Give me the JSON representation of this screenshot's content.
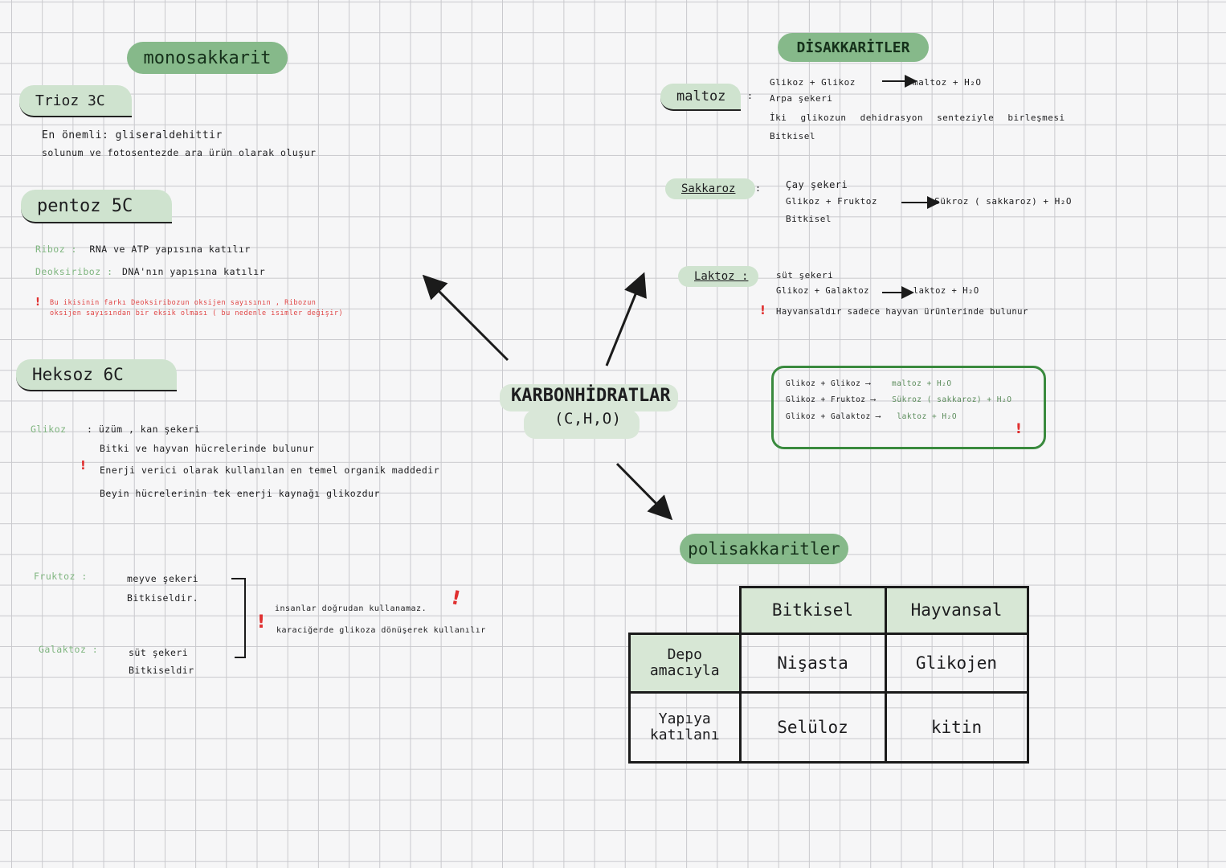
{
  "center": {
    "title": "KARBONHİDRATLAR",
    "formula": "(C,H,O)"
  },
  "monosakkarit": {
    "title": "monosakkarit",
    "trioz": {
      "title": "Trioz 3C",
      "lines": [
        "En önemli: gliseraldehittir",
        "solunum ve fotosentezde ara ürün olarak oluşur"
      ]
    },
    "pentoz": {
      "title": "pentoz 5C",
      "riboz_label": "Riboz :",
      "riboz_text": "RNA ve ATP yapısına katılır",
      "deoksiriboz_label": "Deoksiriboz :",
      "deoksiriboz_text": "DNA'nın yapısına katılır",
      "note_line1": "Bu ikisinin farkı Deoksiribozun oksijen sayısının , Ribozun",
      "note_line2": "oksijen sayısından bir eksik olması ( bu nedenle isimler değişir)"
    },
    "heksoz": {
      "title": "Heksoz 6C",
      "glikoz_label": "Glikoz",
      "glikoz_lines": [
        ": üzüm , kan şekeri",
        "Bitki ve hayvan hücrelerinde bulunur",
        "Enerji verici olarak kullanılan en temel organik maddedir",
        "Beyin hücrelerinin tek enerji kaynağı glikozdur"
      ],
      "fruktoz_label": "Fruktoz :",
      "fruktoz_lines": [
        "meyve şekeri",
        "Bitkiseldir."
      ],
      "galaktoz_label": "Galaktoz :",
      "galaktoz_lines": [
        "süt şekeri",
        "Bitkiseldir"
      ],
      "bracket_note_line1": "insanlar doğrudan kullanamaz.",
      "bracket_note_line2": "karaciğerde glikoza dönüşerek kullanılır"
    }
  },
  "disakkaritler": {
    "title": "DİSAKKARİTLER",
    "maltoz": {
      "label": "maltoz",
      "colon": ":",
      "lines": [
        "Glikoz + Glikoz ⟶ maltoz + H₂O",
        "Arpa şekeri",
        "İki glikozun dehidrasyon senteziyle birleşmesi",
        "Bitkisel"
      ]
    },
    "sakkaroz": {
      "label": "Sakkaroz",
      "colon": ":",
      "lines": [
        "Çay şekeri",
        "Glikoz + Fruktoz ⟶ Sükroz ( sakkaroz) + H₂O",
        "Bitkisel"
      ]
    },
    "laktoz": {
      "label": "Laktoz :",
      "lines": [
        "süt şekeri",
        "Glikoz + Galaktoz ⟶ laktoz + H₂O"
      ],
      "warning_line": "Hayvansaldır sadece hayvan ürünlerinde bulunur"
    },
    "summary_box": {
      "rows": [
        {
          "left": "Glikoz + Glikoz ⟶",
          "right": "maltoz + H₂O"
        },
        {
          "left": "Glikoz + Fruktoz ⟶",
          "right": "Sükroz ( sakkaroz) + H₂O"
        },
        {
          "left": "Glikoz + Galaktoz ⟶",
          "right": "laktoz + H₂O"
        }
      ]
    }
  },
  "polisakkaritler": {
    "title": "polisakkaritler",
    "table": {
      "headers": [
        "Bitkisel",
        "Hayvansal"
      ],
      "rows": [
        {
          "label": "Depo amacıyla",
          "cells": [
            "Nişasta",
            "Glikojen"
          ]
        },
        {
          "label": "Yapıya katılanı",
          "cells": [
            "Selüloz",
            "kitin"
          ]
        }
      ]
    }
  },
  "colors": {
    "pill_dark": "#86b98a",
    "pill_light": "#cfe3cf",
    "accent_green": "#7fb57f",
    "warning_red": "#e04444",
    "grid": "#c9c9cd",
    "box_border": "#3a8a3e"
  }
}
